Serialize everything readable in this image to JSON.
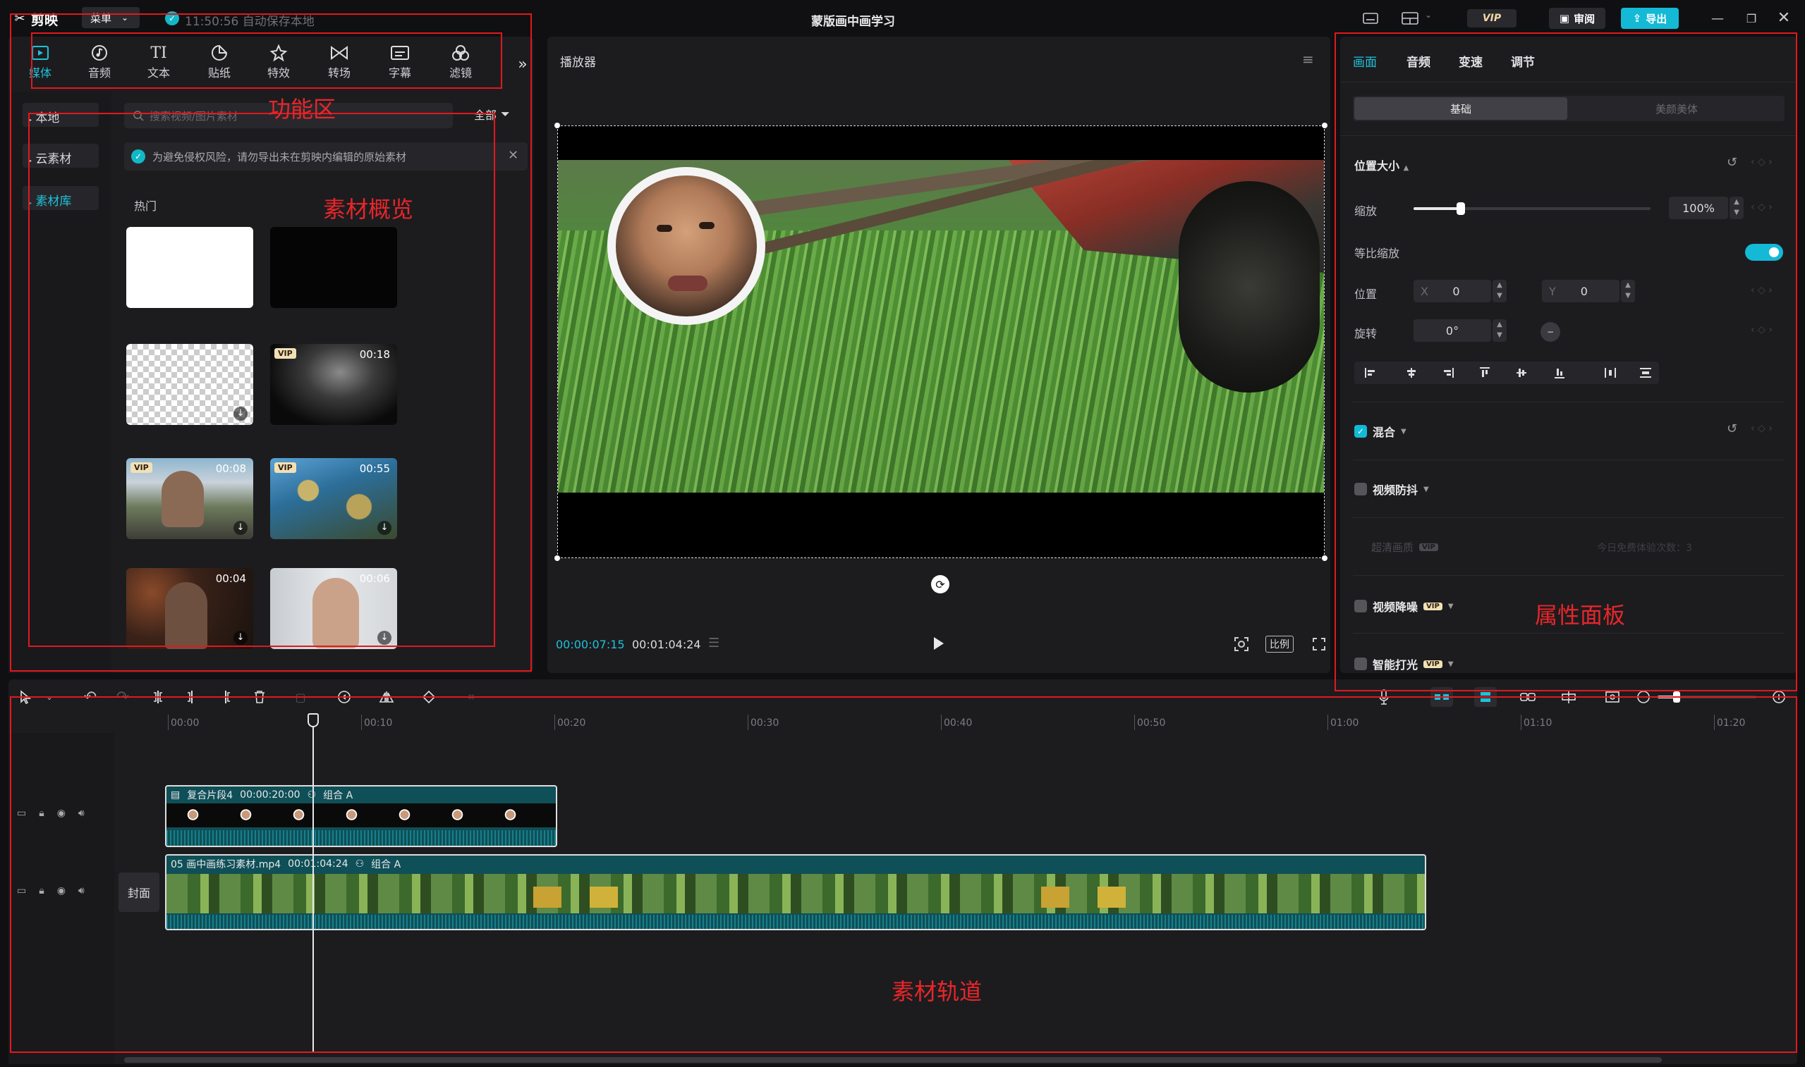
{
  "titlebar": {
    "app_name": "剪映",
    "menu_label": "菜单",
    "autosave": "11:50:56 自动保存本地",
    "project_title": "蒙版画中画学习",
    "vip_label": "VIP",
    "review_label": "审阅",
    "export_label": "导出"
  },
  "func_tabs": [
    {
      "label": "媒体",
      "icon": "media-icon",
      "active": true
    },
    {
      "label": "音频",
      "icon": "audio-icon"
    },
    {
      "label": "文本",
      "icon": "text-icon"
    },
    {
      "label": "贴纸",
      "icon": "sticker-icon"
    },
    {
      "label": "特效",
      "icon": "effects-icon"
    },
    {
      "label": "转场",
      "icon": "transition-icon"
    },
    {
      "label": "字幕",
      "icon": "subtitle-icon"
    },
    {
      "label": "滤镜",
      "icon": "filter-icon"
    }
  ],
  "media_nav": [
    {
      "label": "本地"
    },
    {
      "label": "云素材"
    },
    {
      "label": "素材库",
      "active": true
    }
  ],
  "search": {
    "placeholder": "搜索视频/图片素材",
    "filter_label": "全部"
  },
  "notice": "为避免侵权风险，请勿导出未在剪映内编辑的原始素材",
  "hot_label": "热门",
  "thumbs": [
    {
      "kind": "white"
    },
    {
      "kind": "black"
    },
    {
      "kind": "transparent"
    },
    {
      "kind": "smoke",
      "duration": "00:18",
      "vip": "VIP"
    },
    {
      "kind": "man-tissue",
      "duration": "00:08",
      "vip": "VIP"
    },
    {
      "kind": "flowers",
      "duration": "00:55",
      "vip": "VIP"
    },
    {
      "kind": "man-dark",
      "duration": "00:04"
    },
    {
      "kind": "man-white",
      "duration": "00:06"
    }
  ],
  "annotations": {
    "func": "功能区",
    "overview": "素材概览",
    "props": "属性面板",
    "track": "素材轨道"
  },
  "player": {
    "title": "播放器",
    "current_time": "00:00:07:15",
    "total_time": "00:01:04:24",
    "ratio_label": "比例"
  },
  "props": {
    "tabs": [
      "画面",
      "音频",
      "变速",
      "调节"
    ],
    "subtabs": [
      "基础",
      "美颜美体"
    ],
    "section_position": "位置大小",
    "scale_label": "缩放",
    "scale_value": "100%",
    "scale_level": 0.2,
    "uniform_label": "等比缩放",
    "position_label": "位置",
    "x_label": "X",
    "x_value": "0",
    "y_label": "Y",
    "y_value": "0",
    "rotate_label": "旋转",
    "rotate_value": "0°",
    "blend_label": "混合",
    "stabilize_label": "视频防抖",
    "hd_label": "超清画质",
    "hd_note": "今日免费体验次数：3",
    "denoise_label": "视频降噪",
    "smartlight_label": "智能打光",
    "vip_badge": "VIP"
  },
  "timeline": {
    "ticks": [
      "00:00",
      "00:10",
      "00:20",
      "00:30",
      "00:40",
      "00:50",
      "01:00",
      "01:10",
      "01:20"
    ],
    "cover_label": "封面",
    "clip1": {
      "name": "复合片段4",
      "duration": "00:00:20:00",
      "group": "组合 A"
    },
    "clip2": {
      "name": "05 画中画练习素材.mp4",
      "duration": "00:01:04:24",
      "group": "组合 A"
    }
  }
}
